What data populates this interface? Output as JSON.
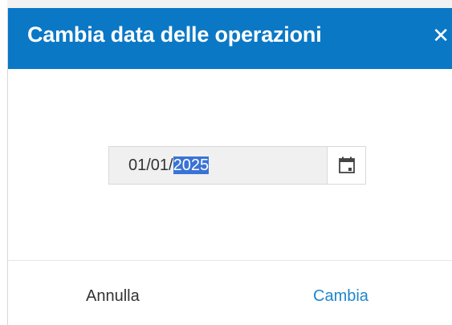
{
  "dialog": {
    "title": "Cambia data delle operazioni",
    "close_icon": "close-icon",
    "close_glyph": "✕",
    "date": {
      "prefix": "01/01/",
      "selected": "2025",
      "calendar_icon": "calendar-icon"
    },
    "buttons": {
      "cancel_label": "Annulla",
      "confirm_label": "Cambia"
    },
    "colors": {
      "header_bg": "#0b78c6",
      "header_text": "#ffffff",
      "selection": "#3a73d6",
      "confirm_text": "#1f86cf"
    }
  }
}
